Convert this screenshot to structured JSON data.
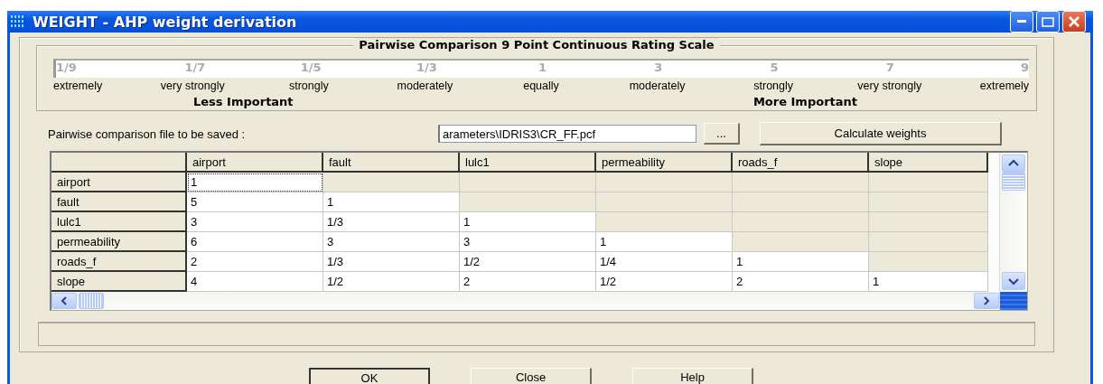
{
  "window": {
    "title": "WEIGHT - AHP weight derivation"
  },
  "scale": {
    "title": "Pairwise Comparison 9 Point Continuous Rating Scale",
    "ticks": [
      {
        "value": "1/9",
        "label": "extremely"
      },
      {
        "value": "1/7",
        "label": "very strongly"
      },
      {
        "value": "1/5",
        "label": "strongly"
      },
      {
        "value": "1/3",
        "label": "moderately"
      },
      {
        "value": "1",
        "label": "equally"
      },
      {
        "value": "3",
        "label": "moderately"
      },
      {
        "value": "5",
        "label": "strongly"
      },
      {
        "value": "7",
        "label": "very strongly"
      },
      {
        "value": "9",
        "label": "extremely"
      }
    ],
    "less": "Less Important",
    "more": "More Important"
  },
  "file": {
    "label": "Pairwise comparison file to be saved :",
    "value": "arameters\\IDRIS3\\CR_FF.pcf",
    "browse": "...",
    "calculate": "Calculate weights"
  },
  "table": {
    "columns": [
      "airport",
      "fault",
      "lulc1",
      "permeability",
      "roads_f",
      "slope"
    ],
    "rows": [
      {
        "label": "airport",
        "cells": [
          {
            "text": "1",
            "focused": true
          }
        ]
      },
      {
        "label": "fault",
        "cells": [
          {
            "text": "5",
            "focused": false
          },
          {
            "text": "1",
            "focused": false
          }
        ]
      },
      {
        "label": "lulc1",
        "cells": [
          {
            "text": "3",
            "focused": false
          },
          {
            "text": "1/3",
            "focused": false
          },
          {
            "text": "1",
            "focused": false
          }
        ]
      },
      {
        "label": "permeability",
        "cells": [
          {
            "text": "6",
            "focused": false
          },
          {
            "text": "3",
            "focused": false
          },
          {
            "text": "3",
            "focused": false
          },
          {
            "text": "1",
            "focused": false
          }
        ]
      },
      {
        "label": "roads_f",
        "cells": [
          {
            "text": "2",
            "focused": false
          },
          {
            "text": "1/3",
            "focused": false
          },
          {
            "text": "1/2",
            "focused": false
          },
          {
            "text": "1/4",
            "focused": false
          },
          {
            "text": "1",
            "focused": false
          }
        ]
      },
      {
        "label": "slope",
        "cells": [
          {
            "text": "4",
            "focused": false
          },
          {
            "text": "1/2",
            "focused": false
          },
          {
            "text": "2",
            "focused": false
          },
          {
            "text": "1/2",
            "focused": false
          },
          {
            "text": "2",
            "focused": false
          },
          {
            "text": "1",
            "focused": false
          }
        ]
      }
    ]
  },
  "buttons": [
    "OK",
    "Close",
    "Help"
  ]
}
